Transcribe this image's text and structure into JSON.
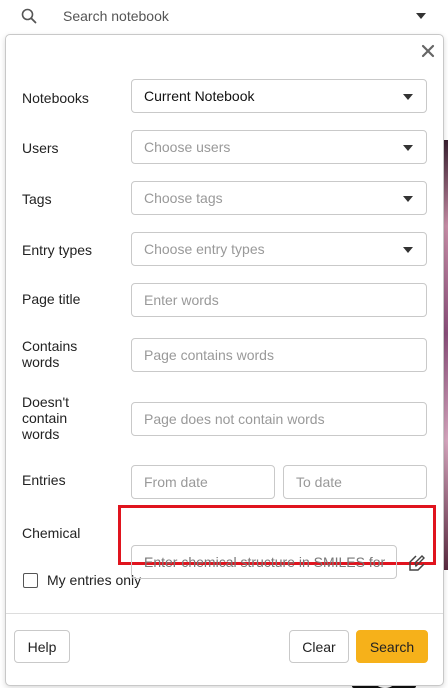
{
  "topbar": {
    "search_label": "Search notebook"
  },
  "form": {
    "notebooks": {
      "label": "Notebooks",
      "value": "Current Notebook"
    },
    "users": {
      "label": "Users",
      "placeholder": "Choose users"
    },
    "tags": {
      "label": "Tags",
      "placeholder": "Choose tags"
    },
    "entry_types": {
      "label": "Entry types",
      "placeholder": "Choose entry types"
    },
    "page_title": {
      "label": "Page title",
      "placeholder": "Enter words"
    },
    "contains_words": {
      "label_line1": "Contains",
      "label_line2": "words",
      "placeholder": "Page contains words"
    },
    "doesnt_contain": {
      "label_line1": "Doesn't",
      "label_line2": "contain",
      "label_line3": "words",
      "placeholder": "Page does not contain words"
    },
    "entries": {
      "label": "Entries",
      "from_placeholder": "From date",
      "to_placeholder": "To date"
    },
    "chemical": {
      "label": "Chemical",
      "placeholder": "Enter chemical structure in SMILES for"
    },
    "my_entries_only": {
      "label": "My entries only",
      "checked": false
    }
  },
  "footer": {
    "help": "Help",
    "clear": "Clear",
    "search": "Search"
  },
  "colors": {
    "accent": "#f6b11a",
    "highlight": "#e0141e"
  }
}
